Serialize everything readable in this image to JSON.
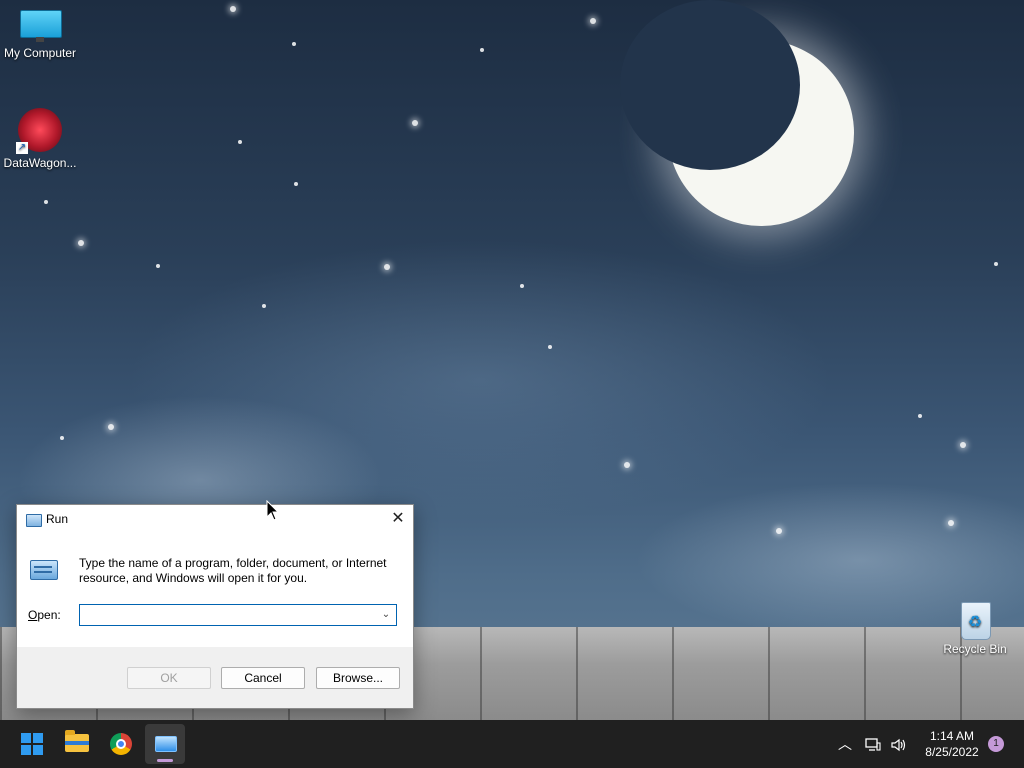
{
  "desktop": {
    "icons": [
      {
        "label": "My Computer"
      },
      {
        "label": "DataWagon..."
      },
      {
        "label": "Recycle Bin"
      }
    ]
  },
  "run_dialog": {
    "title": "Run",
    "description": "Type the name of a program, folder, document, or Internet resource, and Windows will open it for you.",
    "open_label_prefix": "",
    "open_label_accel": "O",
    "open_label_rest": "pen:",
    "open_value": "",
    "ok_label": "OK",
    "cancel_label": "Cancel",
    "browse_label": "Browse...",
    "close_glyph": "✕"
  },
  "taskbar": {
    "apps": [
      "start",
      "file-explorer",
      "chrome",
      "run"
    ],
    "clock_time": "1:14 AM",
    "clock_date": "8/25/2022",
    "notification_count": "1",
    "tray_chevron": "︿"
  }
}
